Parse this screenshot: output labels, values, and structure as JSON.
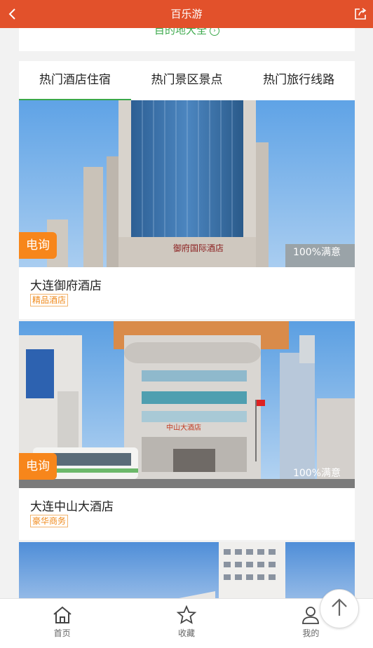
{
  "header": {
    "title": "百乐游",
    "back_icon": "chevron-left-icon",
    "share_icon": "share-icon",
    "background_color": "#e2512b"
  },
  "destination": {
    "link_label": "目的地大全",
    "link_color": "#3aa84a"
  },
  "tabs": [
    {
      "label": "热门酒店住宿",
      "active": true
    },
    {
      "label": "热门景区景点",
      "active": false
    },
    {
      "label": "热门旅行线路",
      "active": false
    }
  ],
  "hotels": [
    {
      "name": "大连御府酒店",
      "tag": "精品酒店",
      "call_label": "电询",
      "satisfaction": "100%满意",
      "image_sign": "御府国际酒店"
    },
    {
      "name": "大连中山大酒店",
      "tag": "豪华商务",
      "call_label": "电询",
      "satisfaction": "100%满意",
      "image_sign": "中山大酒店"
    },
    {
      "name": "",
      "tag": "",
      "call_label": "",
      "satisfaction": ""
    }
  ],
  "tabbar": [
    {
      "label": "首页",
      "icon": "home-icon"
    },
    {
      "label": "收藏",
      "icon": "star-icon"
    },
    {
      "label": "我的",
      "icon": "user-icon"
    }
  ],
  "back_to_top_icon": "arrow-up-icon",
  "colors": {
    "accent_green": "#3aa84a",
    "call_orange": "#f7861b",
    "tag_orange": "#f08a1b"
  }
}
